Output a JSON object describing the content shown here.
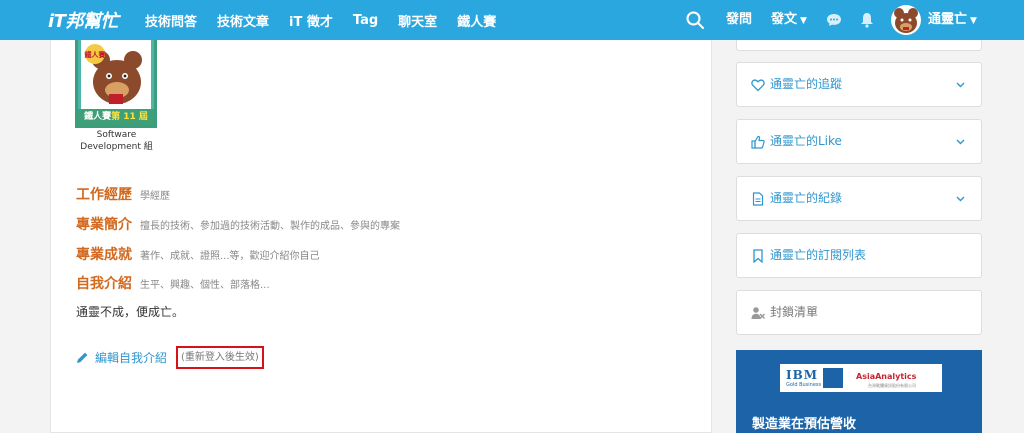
{
  "header": {
    "logo": "iT邦幫忙",
    "nav": [
      "技術問答",
      "技術文章",
      "iT 徵才",
      "Tag",
      "聊天室",
      "鐵人賽"
    ],
    "ask": "發問",
    "post": "發文",
    "user_name": "通靈亡",
    "accent": "#2ba7e0"
  },
  "badge": {
    "top_text": "鐵人賽",
    "edition": "第 11 屆",
    "caption_line1": "Software",
    "caption_line2": "Development 組"
  },
  "profile": {
    "sections": [
      {
        "heading": "工作經歷",
        "hint": "學經歷"
      },
      {
        "heading": "專業簡介",
        "hint": "擅長的技術、參加過的技術活動、製作的成品、參與的專案"
      },
      {
        "heading": "專業成就",
        "hint": "著作、成就、證照...等，歡迎介紹你自己"
      },
      {
        "heading": "自我介紹",
        "hint": "生平、興趣、個性、部落格..."
      }
    ],
    "intro": "通靈不成，便成亡。",
    "edit_label": "編輯自我介紹",
    "edit_note": "(重新登入後生效)"
  },
  "sidebar": {
    "items": [
      {
        "label": "通靈亡的追蹤",
        "icon": "heart-icon"
      },
      {
        "label": "通靈亡的Like",
        "icon": "thumbs-up-icon"
      },
      {
        "label": "通靈亡的紀錄",
        "icon": "document-icon"
      },
      {
        "label": "通靈亡的訂閱列表",
        "icon": "bookmark-icon"
      },
      {
        "label": "封鎖清單",
        "icon": "user-block-icon"
      }
    ],
    "ad": {
      "brand1": "IBM",
      "brand1_sub": "Gold Business Partner",
      "brand2": "AsiaAnalytics",
      "brand2_sub": "台灣軟體資訊股份有限公司",
      "headline": "製造業在預估營收"
    }
  }
}
